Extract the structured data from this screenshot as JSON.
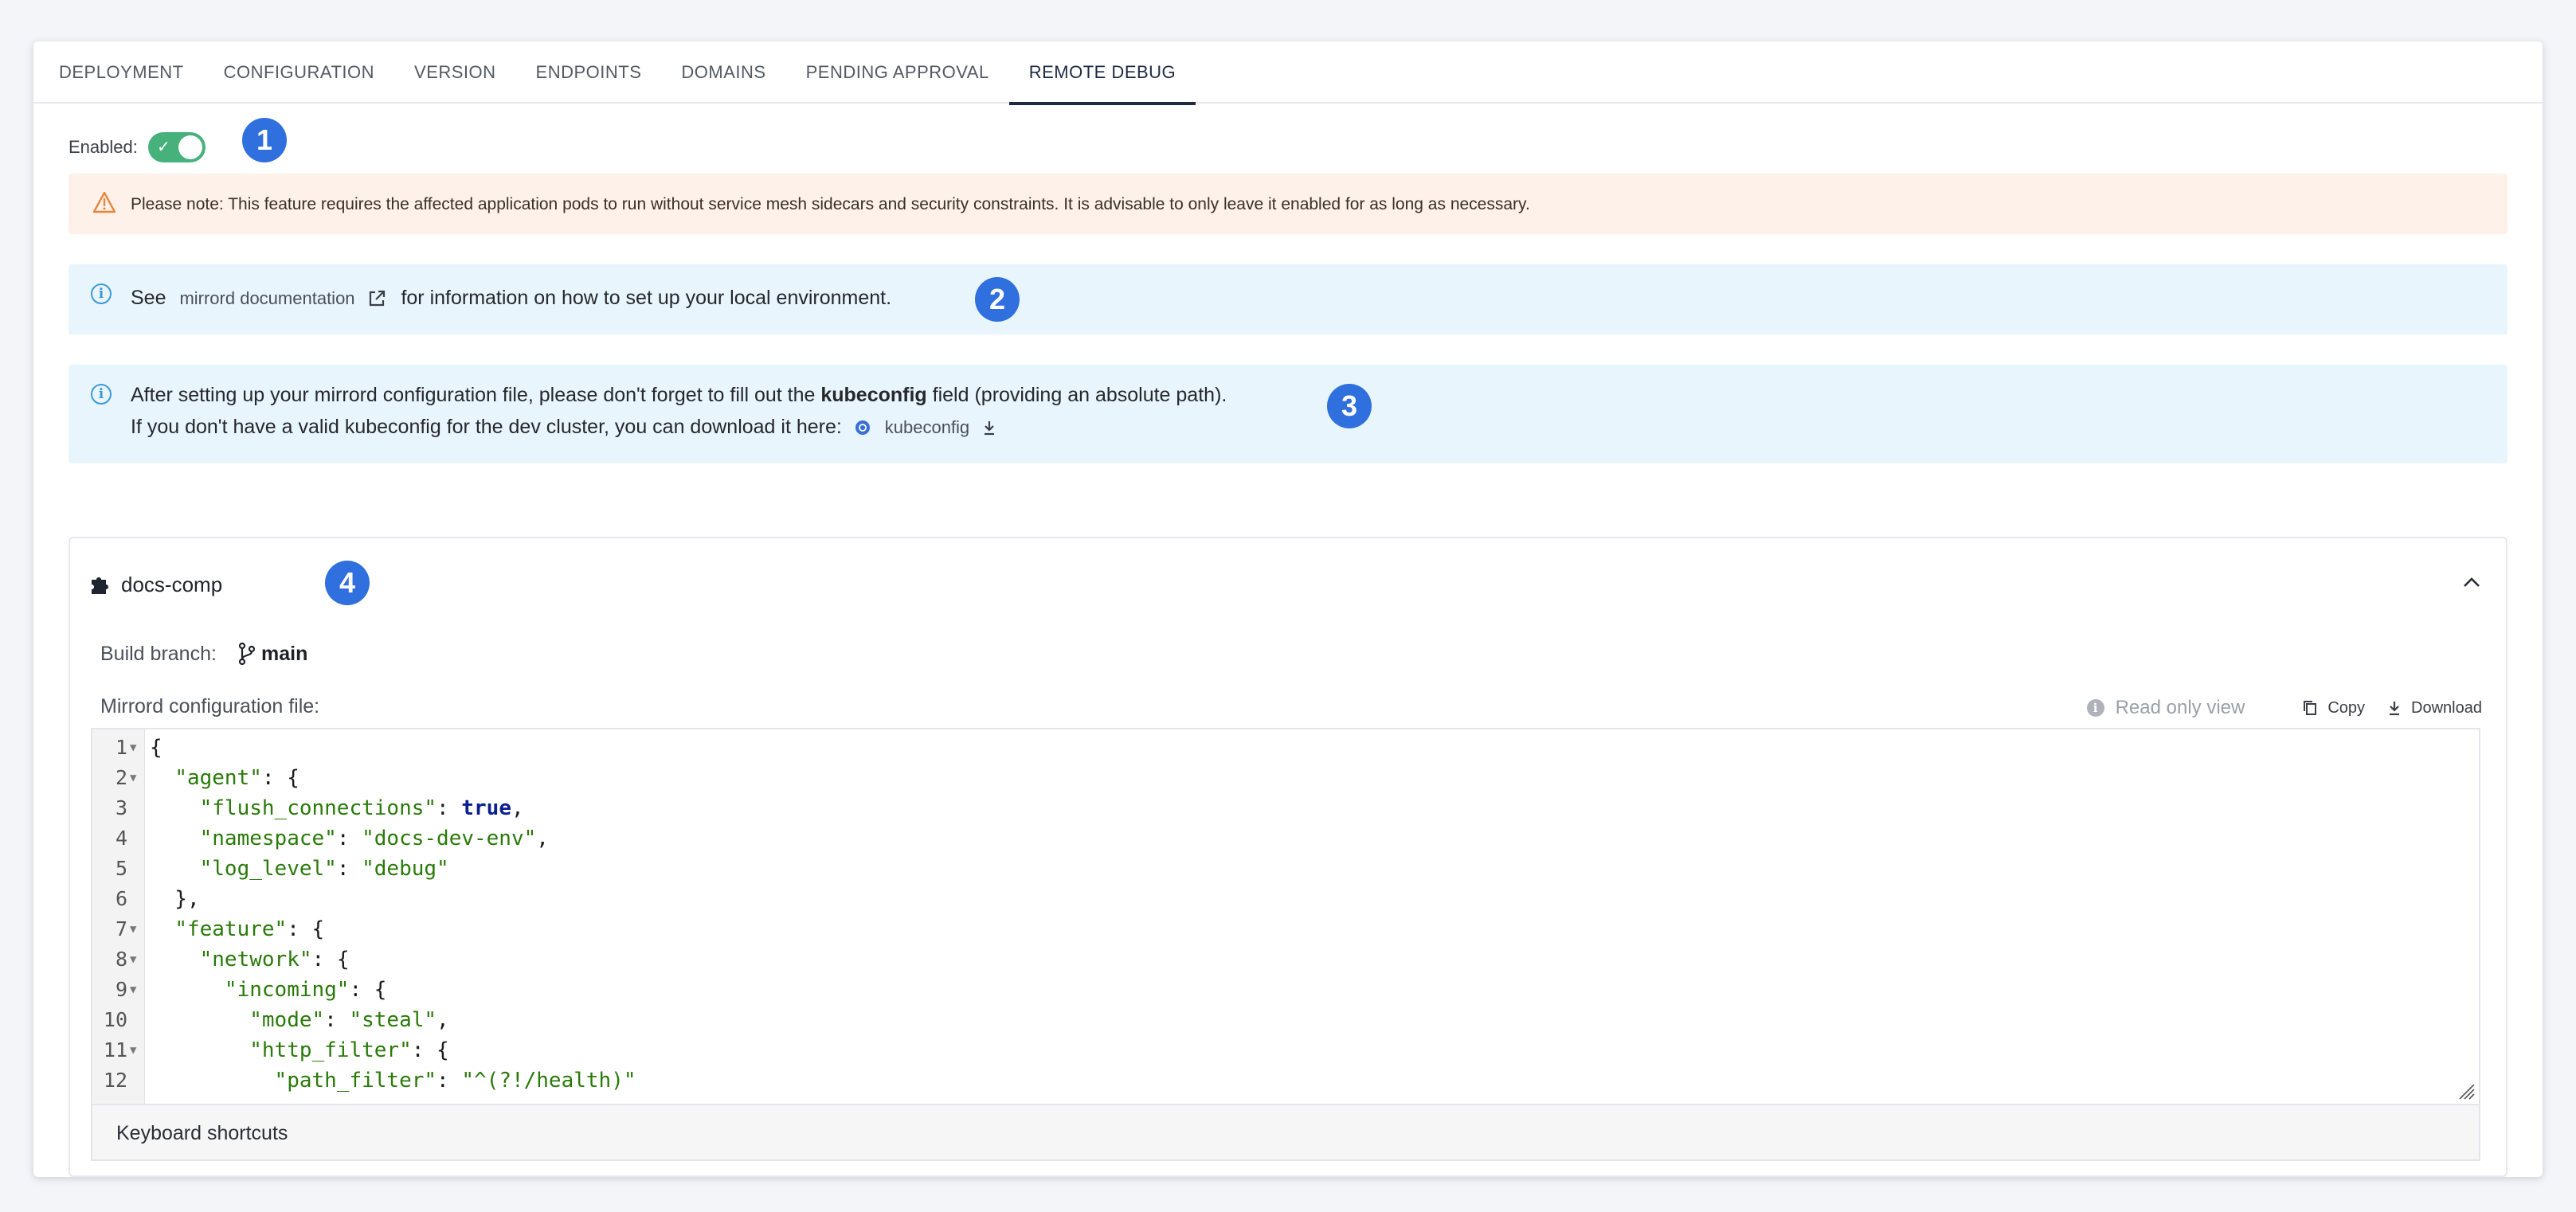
{
  "tabs": [
    {
      "label": "DEPLOYMENT"
    },
    {
      "label": "CONFIGURATION"
    },
    {
      "label": "VERSION"
    },
    {
      "label": "ENDPOINTS"
    },
    {
      "label": "DOMAINS"
    },
    {
      "label": "PENDING APPROVAL"
    },
    {
      "label": "REMOTE DEBUG",
      "active": true
    }
  ],
  "enabled": {
    "label": "Enabled:",
    "checked": true,
    "check_glyph": "✓"
  },
  "markers": [
    "1",
    "2",
    "3",
    "4"
  ],
  "warning": {
    "icon": "warning-triangle-icon",
    "text": "Please note: This feature requires the affected application pods to run without service mesh sidecars and security constraints. It is advisable to only leave it enabled for as long as necessary."
  },
  "doc_info": {
    "prefix": "See",
    "link_label": "mirrord documentation",
    "suffix": "for information on how to set up your local environment."
  },
  "kube_info": {
    "line1_prefix": "After setting up your mirrord configuration file, please don't forget to fill out the",
    "line1_bold": "kubeconfig",
    "line1_suffix": "field (providing an absolute path).",
    "line2_prefix": "If you don't have a valid kubeconfig for the dev cluster, you can download it here:",
    "download_label": "kubeconfig"
  },
  "component": {
    "name": "docs-comp",
    "build_branch_label": "Build branch:",
    "branch": "main",
    "file_label": "Mirrord configuration file:",
    "read_only_label": "Read only view",
    "copy_label": "Copy",
    "download_label": "Download",
    "keyboard_shortcuts_label": "Keyboard shortcuts"
  },
  "code_lines": [
    {
      "n": "1",
      "fold": true
    },
    {
      "n": "2",
      "fold": true
    },
    {
      "n": "3",
      "fold": false
    },
    {
      "n": "4",
      "fold": false
    },
    {
      "n": "5",
      "fold": false
    },
    {
      "n": "6",
      "fold": false
    },
    {
      "n": "7",
      "fold": true
    },
    {
      "n": "8",
      "fold": true
    },
    {
      "n": "9",
      "fold": true
    },
    {
      "n": "10",
      "fold": false
    },
    {
      "n": "11",
      "fold": true
    },
    {
      "n": "12",
      "fold": false
    }
  ],
  "code_tokens": {
    "agent": "\"agent\"",
    "flush_connections": "\"flush_connections\"",
    "true": "true",
    "namespace": "\"namespace\"",
    "namespace_val": "\"docs-dev-env\"",
    "log_level": "\"log_level\"",
    "log_level_val": "\"debug\"",
    "feature": "\"feature\"",
    "network": "\"network\"",
    "incoming": "\"incoming\"",
    "mode": "\"mode\"",
    "mode_val": "\"steal\"",
    "http_filter": "\"http_filter\"",
    "path_filter": "\"path_filter\"",
    "path_filter_val": "\"^(?!/health)\""
  },
  "colors": {
    "accent": "#1e2a44",
    "toggle_on": "#46b17b",
    "marker": "#2f6fde",
    "info_bg": "#e9f5fc",
    "warn_bg": "#fdf1ea"
  }
}
